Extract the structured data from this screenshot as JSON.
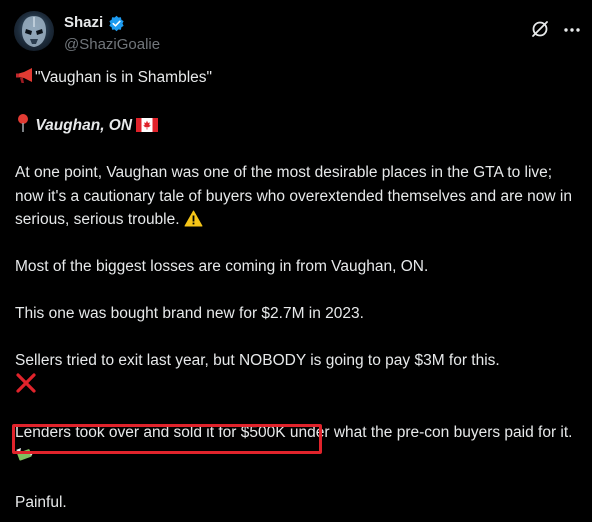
{
  "author": {
    "display_name": "Shazi",
    "handle": "@ShaziGoalie",
    "verified": true
  },
  "icons": {
    "verified": "verified-badge-icon",
    "grok": "grok-icon",
    "more": "more-options-icon",
    "megaphone": "megaphone-emoji",
    "pin": "round-pushpin-emoji",
    "flag": "canada-flag-emoji",
    "warning": "warning-emoji",
    "cross": "cross-mark-emoji",
    "money": "money-with-wings-emoji"
  },
  "post": {
    "headline": "\"Vaughan is in Shambles\"",
    "location": "Vaughan, ON",
    "para1": "At one point, Vaughan was one of the most desirable places in the GTA to live; now it's a cautionary tale of buyers who overextended themselves and are now in serious, serious trouble.",
    "para2": "Most of the biggest losses are coming in from Vaughan, ON.",
    "para3": "This one was bought brand new for $2.7M in 2023.",
    "para4": "Sellers tried to exit last year, but NOBODY is going to pay $3M for this.",
    "para5_highlight": "Lenders took over and sold it for $500K",
    "para5_rest": " under what the pre-con buyers paid for it.",
    "para6": "Painful."
  },
  "colors": {
    "background": "#000000",
    "text": "#e7e9ea",
    "muted": "#71767b",
    "verified_blue": "#1d9bf0",
    "highlight_red": "#e0232b"
  }
}
